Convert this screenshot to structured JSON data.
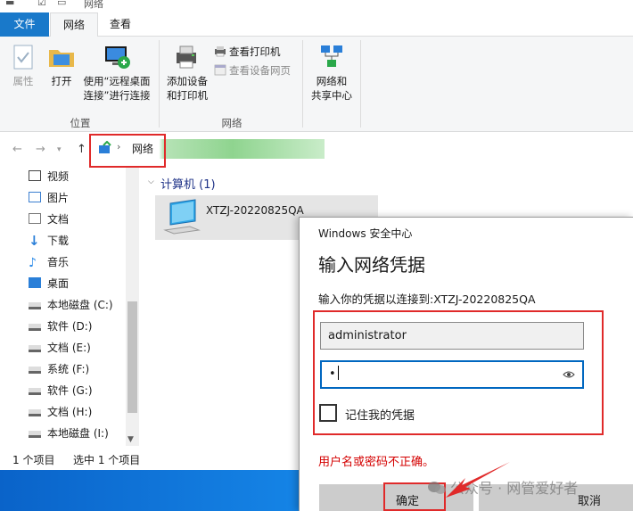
{
  "window": {
    "title": "网络"
  },
  "tabs": [
    {
      "label": "文件"
    },
    {
      "label": "网络"
    },
    {
      "label": "查看"
    }
  ],
  "ribbon": {
    "properties": "属性",
    "open": "打开",
    "remote_line1": "使用“远程桌面",
    "remote_line2": "连接”进行连接",
    "location_group": "位置",
    "add_device_line1": "添加设备",
    "add_device_line2": "和打印机",
    "view_printers": "查看打印机",
    "view_device_webpage": "查看设备网页",
    "network_group": "网络",
    "sharing_line1": "网络和",
    "sharing_line2": "共享中心"
  },
  "address": {
    "crumb": "网络"
  },
  "sidebar": {
    "items": [
      {
        "label": "视频",
        "icon": "video-icon"
      },
      {
        "label": "图片",
        "icon": "picture-icon"
      },
      {
        "label": "文档",
        "icon": "document-icon"
      },
      {
        "label": "下载",
        "icon": "download-icon"
      },
      {
        "label": "音乐",
        "icon": "music-icon"
      },
      {
        "label": "桌面",
        "icon": "desktop-icon"
      },
      {
        "label": "本地磁盘 (C:)",
        "icon": "drive-icon"
      },
      {
        "label": "软件 (D:)",
        "icon": "drive-icon"
      },
      {
        "label": "文档 (E:)",
        "icon": "drive-icon"
      },
      {
        "label": "系统 (F:)",
        "icon": "drive-icon"
      },
      {
        "label": "软件 (G:)",
        "icon": "drive-icon"
      },
      {
        "label": "文档 (H:)",
        "icon": "drive-icon"
      },
      {
        "label": "本地磁盘 (I:)",
        "icon": "drive-icon"
      }
    ]
  },
  "main": {
    "group_title": "计算机 (1)",
    "computer_name": "XTZJ-20220825QA"
  },
  "status": {
    "count": "1 个项目",
    "selected": "选中 1 个项目"
  },
  "dialog": {
    "caption": "Windows 安全中心",
    "title": "输入网络凭据",
    "subtitle": "输入你的凭据以连接到:XTZJ-20220825QA",
    "username": "administrator",
    "password_mask": "•",
    "remember": "记住我的凭据",
    "error": "用户名或密码不正确。",
    "ok": "确定",
    "cancel": "取消"
  },
  "watermark": "公众号 · 网管爱好者",
  "colors": {
    "accent": "#1979ca",
    "highlight": "#e02a2a",
    "error": "#d40000",
    "focus": "#0067c0"
  }
}
